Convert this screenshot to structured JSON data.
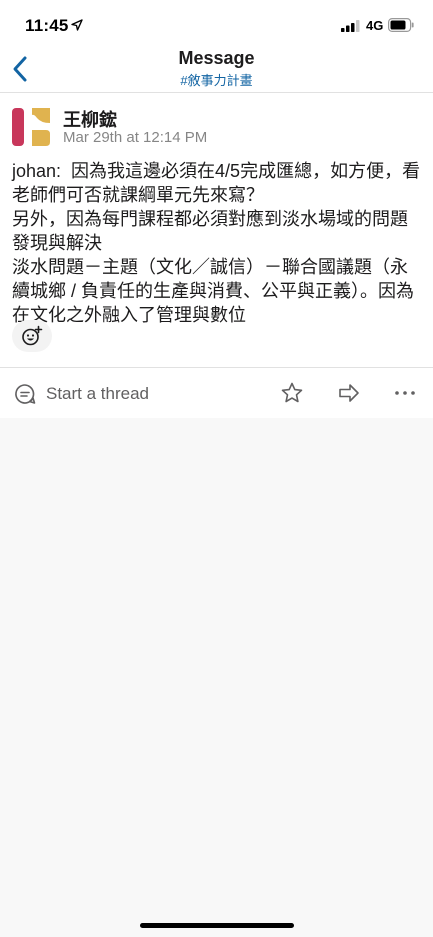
{
  "status_bar": {
    "time": "11:45",
    "network": "4G"
  },
  "nav": {
    "title": "Message",
    "channel": "#敘事力計畫"
  },
  "message": {
    "author": "王柳鋐",
    "timestamp": "Mar 29th at 12:14 PM",
    "body": "johan:  因為我這邊必須在4/5完成匯總，如方便，看老師們可否就課綱單元先來寫？\n另外，因為每門課程都必須對應到淡水場域的問題發現與解決\n淡水問題－主題（文化／誠信）－聯合國議題（永續城鄉 / 負責任的生產與消費、公平與正義）。因為在文化之外融入了管理與數位"
  },
  "thread_bar": {
    "start_thread_label": "Start a thread"
  },
  "colors": {
    "accent": "#1264a3",
    "avatar_red": "#c8375b",
    "avatar_gold": "#e0b34f"
  }
}
